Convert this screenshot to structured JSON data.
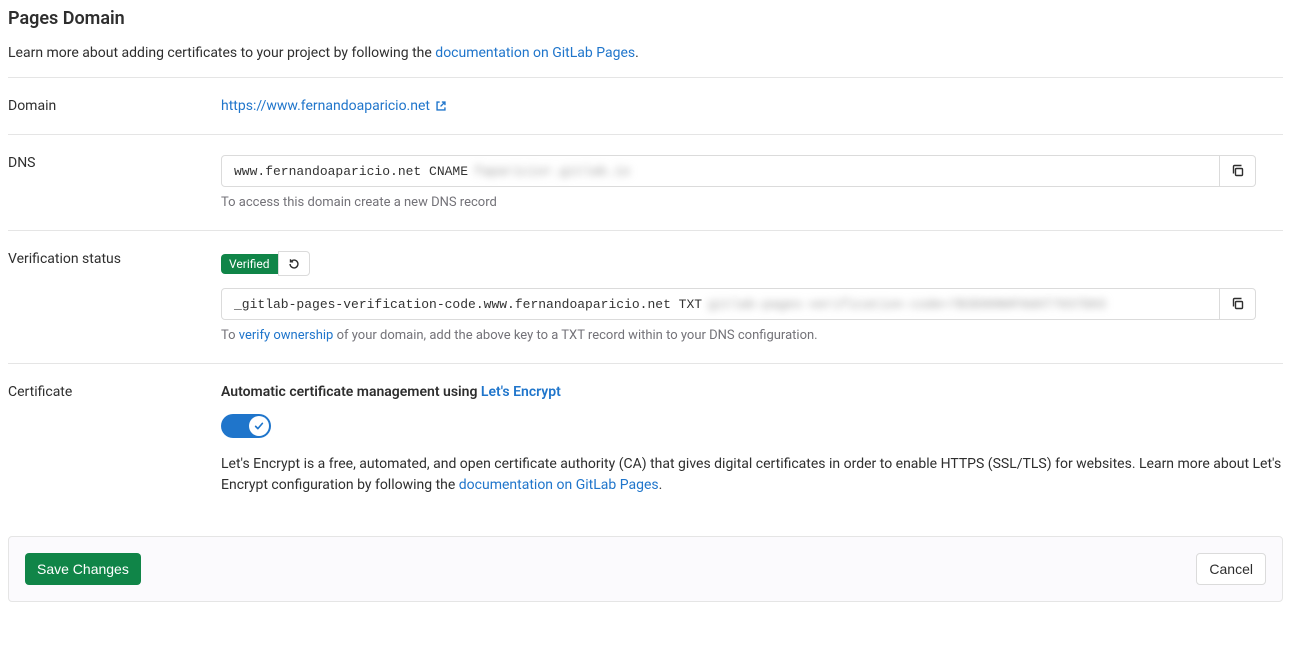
{
  "header": {
    "title": "Pages Domain",
    "intro_prefix": "Learn more about adding certificates to your project by following the ",
    "intro_link": "documentation on GitLab Pages",
    "intro_suffix": "."
  },
  "domain": {
    "label": "Domain",
    "url": "https://www.fernandoaparicio.net"
  },
  "dns": {
    "label": "DNS",
    "record_visible": "www.fernandoaparicio.net CNAME ",
    "record_hidden": "faparicior.gitlab.io",
    "help": "To access this domain create a new DNS record"
  },
  "verification": {
    "label": "Verification status",
    "badge": "Verified",
    "txt_visible": "_gitlab-pages-verification-code.www.fernandoaparicio.net TXT ",
    "txt_hidden": "gitlab-pages-verification-code=7B3D90NHF0dAT7937D03",
    "help_prefix": "To ",
    "help_link": "verify ownership",
    "help_suffix": " of your domain, add the above key to a TXT record within to your DNS configuration."
  },
  "certificate": {
    "label": "Certificate",
    "heading_prefix": "Automatic certificate management using ",
    "heading_link": "Let's Encrypt",
    "toggle_on": true,
    "desc_prefix": "Let's Encrypt is a free, automated, and open certificate authority (CA) that gives digital certificates in order to enable HTTPS (SSL/TLS) for websites. Learn more about Let's Encrypt configuration by following the ",
    "desc_link": "documentation on GitLab Pages",
    "desc_suffix": "."
  },
  "footer": {
    "save": "Save Changes",
    "cancel": "Cancel"
  }
}
